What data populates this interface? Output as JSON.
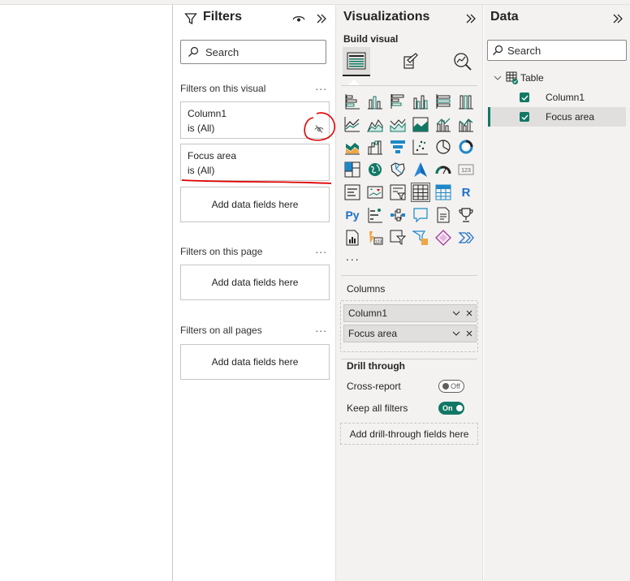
{
  "filters": {
    "title": "Filters",
    "search_placeholder": "Search",
    "on_visual_label": "Filters on this visual",
    "on_page_label": "Filters on this page",
    "on_all_pages_label": "Filters on all pages",
    "more": "...",
    "cards": [
      {
        "field": "Column1",
        "state": "is (All)"
      },
      {
        "field": "Focus area",
        "state": "is (All)"
      }
    ],
    "add_fields": "Add data fields here"
  },
  "visualizations": {
    "title": "Visualizations",
    "build_visual_label": "Build visual",
    "more": "...",
    "icon_r": "R",
    "icon_py": "Py",
    "icon_123": "123",
    "columns_label": "Columns",
    "columns": [
      "Column1",
      "Focus area"
    ],
    "drill_through_label": "Drill through",
    "cross_report_label": "Cross-report",
    "cross_report_state": "Off",
    "keep_filters_label": "Keep all filters",
    "keep_filters_state": "On",
    "add_drill_label": "Add drill-through fields here"
  },
  "data_pane": {
    "title": "Data",
    "search_placeholder": "Search",
    "table_name": "Table",
    "fields": [
      "Column1",
      "Focus area"
    ]
  },
  "colors": {
    "accent": "#117865",
    "annotation": "#e00000"
  }
}
